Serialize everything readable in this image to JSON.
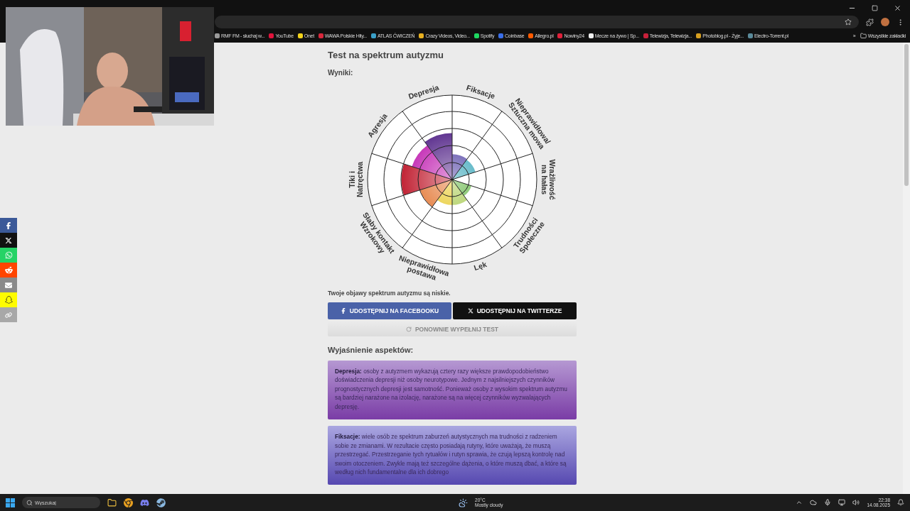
{
  "window_controls": [
    {
      "kind": "minimize"
    },
    {
      "kind": "maximize"
    },
    {
      "kind": "close"
    }
  ],
  "bookmarks": [
    {
      "label": "RMF FM - słuchaj w...",
      "color": "#9a9a9a"
    },
    {
      "label": "YouTube",
      "color": "#e0143c"
    },
    {
      "label": "Onet",
      "color": "#f2d21b"
    },
    {
      "label": "WAWA Polskie Hity...",
      "color": "#d8283c"
    },
    {
      "label": "ATLAS ĆWICZEŃ",
      "color": "#3aa0c8"
    },
    {
      "label": "Crazy Videos, Video...",
      "color": "#e8b020"
    },
    {
      "label": "Spotify",
      "color": "#1ed760"
    },
    {
      "label": "Coinbase",
      "color": "#3a6ee8"
    },
    {
      "label": "Allegro.pl",
      "color": "#ff5a00"
    },
    {
      "label": "Nowiny24",
      "color": "#e0203a"
    },
    {
      "label": "Mecze na żywo | Sp...",
      "color": "#f0f0f0"
    },
    {
      "label": "Telewizja, Telewizja...",
      "color": "#c8203a"
    },
    {
      "label": "Photoblog.pl - Żyje...",
      "color": "#d8a020"
    },
    {
      "label": "Electro-Torrent.pl",
      "color": "#5a8a9a"
    }
  ],
  "bookmarks_more": "»",
  "all_bookmarks": "Wszystkie zakładki",
  "page": {
    "title": "Test na spektrum autyzmu",
    "results_label": "Wyniki:",
    "aspects": [
      {
        "lines": [
          "Fiksacje"
        ]
      },
      {
        "lines": [
          "Nieprawidłowa/",
          "Sztuczna mowa"
        ]
      },
      {
        "lines": [
          "Wrażliwość",
          "na hałas"
        ]
      },
      {
        "lines": [
          "Trudności",
          "Społeczne"
        ]
      },
      {
        "lines": [
          "Lęk"
        ]
      },
      {
        "lines": [
          "Nieprawidłowa",
          "postawa"
        ]
      },
      {
        "lines": [
          "Słaby kontakt",
          "Wzrokowy"
        ]
      },
      {
        "lines": [
          "Tiki i",
          "Natręctwa"
        ]
      },
      {
        "lines": [
          "Agresja"
        ]
      },
      {
        "lines": [
          "Depresja"
        ]
      }
    ],
    "summary": "Twoje objawy spektrum autyzmu są niskie.",
    "share_buttons": [
      {
        "kind": "facebook",
        "label": "UDOSTĘPNIJ NA FACEBOOKU"
      },
      {
        "kind": "twitter",
        "label": "UDOSTĘPNIJ NA TWITTERZE"
      }
    ],
    "retake_button": "PONOWNIE WYPEŁNIJ TEST",
    "explanations_title": "Wyjaśnienie aspektów:",
    "explanations": [
      {
        "kind": "purple",
        "text": "**Depresja:** osoby z autyzmem wykazują cztery razy większe prawdopodobieństwo doświadczenia depresji niż osoby neurotypowe. Jednym z najsilniejszych czynników prognostycznych depresji jest samotność. Ponieważ osoby z wysokim spektrum autyzmu są bardziej narażone na izolację, narażone są na więcej czynników wyzwalających depresję."
      },
      {
        "kind": "indigo",
        "text": "**Fiksacje:** wiele osób ze spektrum zaburzeń autystycznych ma trudności z radzeniem sobie ze zmianami. W rezultacie często posiadają rutyny, które uważają, że muszą przestrzegać. Przestrzeganie tych rytuałów i rutyn sprawia, że czują lepszą kontrolę nad swoim otoczeniem. Zwykle mają też szczególne dążenia, o które muszą dbać, a które są według nich fundamentalne dla ich dobrego"
      }
    ]
  },
  "side_share": [
    {
      "kind": "facebook",
      "color": "#3b5998"
    },
    {
      "kind": "x",
      "color": "#111111"
    },
    {
      "kind": "whatsapp",
      "color": "#25d366"
    },
    {
      "kind": "reddit",
      "color": "#ff4500"
    },
    {
      "kind": "email",
      "color": "#8a8a8a"
    },
    {
      "kind": "snapchat",
      "color": "#fffc00"
    },
    {
      "kind": "link",
      "color": "#a8a8a8"
    }
  ],
  "taskbar": {
    "search_placeholder": "Wyszukaj",
    "weather_temp": "20°C",
    "weather_text": "Mostly cloudy",
    "time": "22:38",
    "date": "14.08.2025"
  }
}
